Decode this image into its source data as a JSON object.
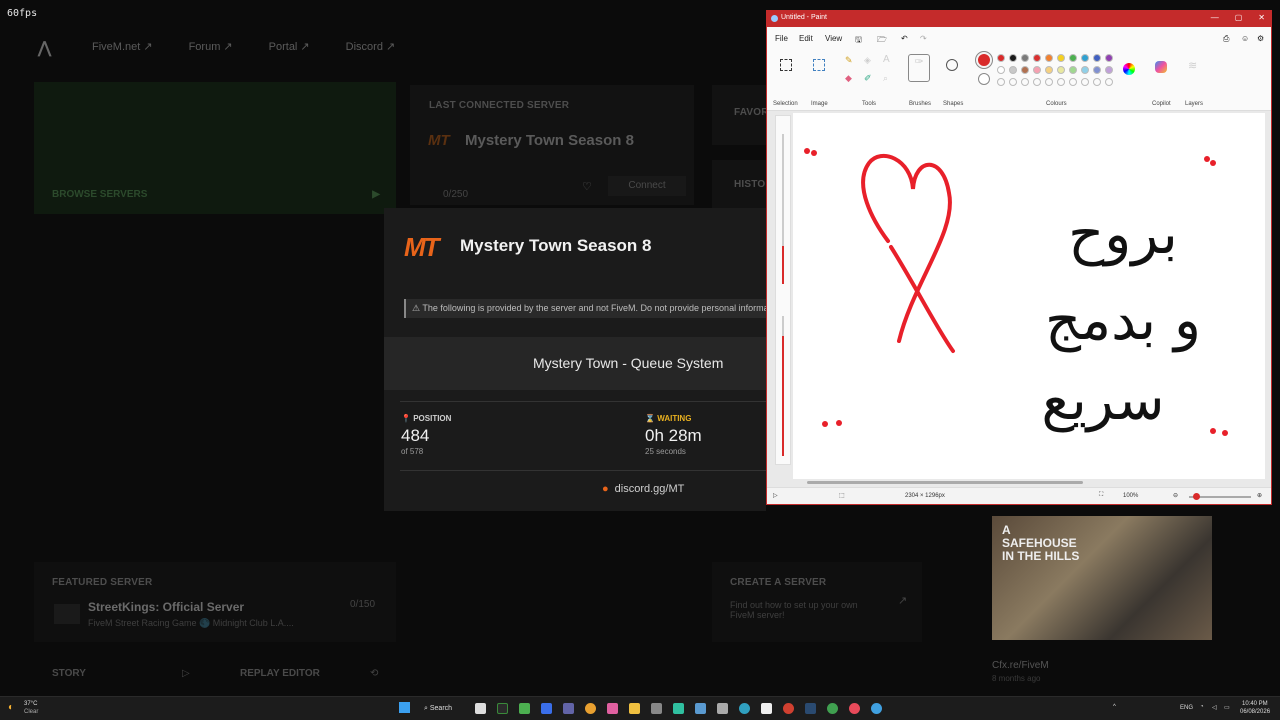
{
  "overlay": {
    "fps": "60fps"
  },
  "nav": {
    "links": [
      "FiveM.net ↗",
      "Forum ↗",
      "Portal ↗",
      "Discord ↗"
    ]
  },
  "browse": {
    "label": "BROWSE SERVERS",
    "arrow": "▶"
  },
  "last_connected": {
    "heading": "LAST CONNECTED SERVER",
    "server_name": "Mystery Town Season 8",
    "players": "0/250",
    "connect_label": "Connect"
  },
  "side_headers": {
    "favorites": "FAVOR",
    "history": "HISTO"
  },
  "modal": {
    "logo": "MT",
    "title": "Mystery Town Season 8",
    "notice": "The following is provided by the server and not FiveM. Do not provide personal informatio",
    "queue_title": "Mystery Town - Queue System",
    "position": {
      "label": "POSITION",
      "value": "484",
      "sub": "of 578"
    },
    "waiting": {
      "label": "WAITING",
      "value": "0h 28m",
      "sub": "25 seconds"
    },
    "discord": "discord.gg/MT"
  },
  "paint": {
    "title": "Untitled - Paint",
    "menus": [
      "File",
      "Edit",
      "View"
    ],
    "groups": [
      "Selection",
      "Image",
      "Tools",
      "Brushes",
      "Shapes",
      "Colours",
      "Copilot",
      "Layers"
    ],
    "colors": [
      "#d92a2a",
      "#1a1a1a",
      "#7a7a7a",
      "#d93030",
      "#f08030",
      "#f5d020",
      "#4cb050",
      "#30a0d0",
      "#4060c0",
      "#9040b0",
      "#ffffff",
      "#c8c8c8",
      "#b07050",
      "#f5a0b0",
      "#f5d080",
      "#e8e8a0",
      "#a0d890",
      "#90d0e8",
      "#8090d0",
      "#c0a0d8"
    ],
    "arabic_lines": [
      "بروح",
      "و بدمج",
      "سريع"
    ],
    "status_size": "2304 × 1296px",
    "zoom": "100%"
  },
  "featured": {
    "heading": "FEATURED SERVER",
    "name": "StreetKings: Official Server",
    "desc": "FiveM Street Racing Game 🌑 Midnight Club L.A....",
    "players": "0/150"
  },
  "bottom": {
    "story": "STORY",
    "replay": "REPLAY EDITOR"
  },
  "create": {
    "heading": "CREATE A SERVER",
    "desc": "Find out how to set up your own FiveM server!"
  },
  "news": {
    "thumb_text": "A SAFEHOUSE IN THE HILLS",
    "source": "Cfx.re/FiveM",
    "time": "8 months ago"
  },
  "taskbar": {
    "weather_temp": "37°C",
    "weather_desc": "Clear",
    "search": "Search",
    "lang": "ENG",
    "time": "10:40 PM",
    "date": "06/08/2026"
  }
}
